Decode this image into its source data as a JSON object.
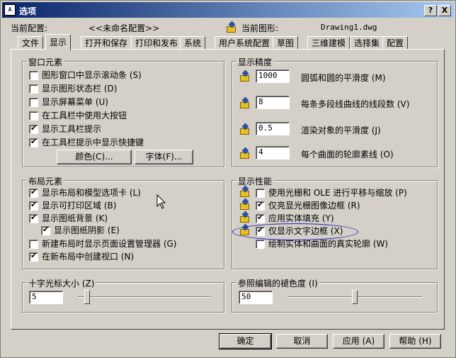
{
  "window": {
    "title": "选项",
    "icon_name": "autocad-options-icon",
    "help_button": "?",
    "close_button": "X"
  },
  "profile": {
    "label": "当前配置:",
    "value": "<<未命名配置>>",
    "drawing_label": "当前图形:",
    "drawing_value": "Drawing1.dwg"
  },
  "tabs": [
    "文件",
    "显示",
    "打开和保存",
    "打印和发布",
    "系统",
    "用户系统配置",
    "草图",
    "三维建模",
    "选择集",
    "配置"
  ],
  "active_tab": "显示",
  "window_elements": {
    "title": "窗口元素",
    "items": [
      {
        "label": "图形窗口中显示滚动条 (S)",
        "checked": false
      },
      {
        "label": "显示图形状态栏 (D)",
        "checked": false
      },
      {
        "label": "显示屏幕菜单 (U)",
        "checked": false
      },
      {
        "label": "在工具栏中使用大按钮",
        "checked": false
      },
      {
        "label": "显示工具栏提示",
        "checked": true
      },
      {
        "label": "在工具栏提示中显示快捷键",
        "checked": true
      }
    ],
    "colors_button": "颜色(C)...",
    "fonts_button": "字体(F)..."
  },
  "display_resolution": {
    "title": "显示精度",
    "items": [
      {
        "value": "1000",
        "label": "圆弧和圆的平滑度 (M)"
      },
      {
        "value": "8",
        "label": "每条多段线曲线的线段数 (V)"
      },
      {
        "value": "0.5",
        "label": "渲染对象的平滑度 (J)"
      },
      {
        "value": "4",
        "label": "每个曲面的轮廓素线 (O)"
      }
    ]
  },
  "layout_elements": {
    "title": "布局元素",
    "items": [
      {
        "label": "显示布局和模型选项卡 (L)",
        "checked": true
      },
      {
        "label": "显示可打印区域 (B)",
        "checked": true
      },
      {
        "label": "显示图纸背景 (K)",
        "checked": true
      },
      {
        "label": "显示图纸阴影 (E)",
        "checked": true
      },
      {
        "label": "新建布局时显示页面设置管理器 (G)",
        "checked": false
      },
      {
        "label": "在新布局中创建视口 (N)",
        "checked": true
      }
    ]
  },
  "display_performance": {
    "title": "显示性能",
    "items": [
      {
        "label": "使用光栅和 OLE 进行平移与缩放 (P)",
        "checked": false
      },
      {
        "label": "仅亮显光栅图像边框 (R)",
        "checked": true
      },
      {
        "label": "应用实体填充 (Y)",
        "checked": true
      },
      {
        "label": "仅显示文字边框 (X)",
        "checked": true
      },
      {
        "label": "绘制实体和曲面的真实轮廓 (W)",
        "checked": false
      }
    ]
  },
  "crosshair": {
    "title": "十字光标大小 (Z)",
    "value": "5",
    "slider_fraction": 0.05
  },
  "xref_fade": {
    "title": "参照编辑的褪色度 (I)",
    "value": "50",
    "slider_fraction": 0.5
  },
  "buttons": {
    "ok": "确定",
    "cancel": "取消",
    "apply": "应用 (A)",
    "help": "帮助 (H)"
  },
  "colors": {
    "title_start": "#0a246a",
    "title_end": "#a6caf0",
    "face": "#d4d0c8",
    "highlight_ellipse": "#2020c0"
  }
}
